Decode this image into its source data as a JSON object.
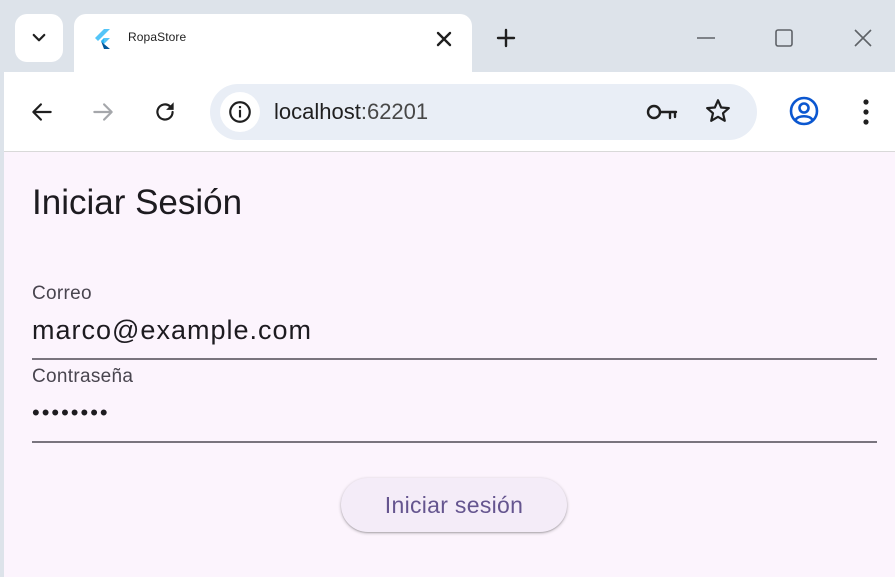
{
  "browser": {
    "tab": {
      "title": "RopaStore",
      "favicon": "flutter-logo-icon"
    },
    "omnibox": {
      "host": "localhost",
      "port": ":62201"
    },
    "icons": {
      "tab_search": "chevron-down-icon",
      "tab_close": "close-icon",
      "new_tab": "plus-icon",
      "minimize": "minimize-icon",
      "maximize": "maximize-icon",
      "window_close": "close-icon",
      "back": "arrow-left-icon",
      "forward": "arrow-right-icon",
      "reload": "reload-icon",
      "site_info": "info-icon",
      "password": "key-icon",
      "bookmark": "star-icon",
      "profile": "account-circle-icon",
      "menu": "more-vertical-icon"
    }
  },
  "page": {
    "title": "Iniciar Sesión",
    "email": {
      "label": "Correo",
      "value": "marco@example.com"
    },
    "password": {
      "label": "Contraseña",
      "value": "••••••••"
    },
    "submit_label": "Iniciar sesión"
  },
  "colors": {
    "page_background": "#fcf4fd",
    "accent": "#65558f",
    "profile_icon": "#0b57d0",
    "tab_strip": "#dde3ea",
    "omnibox": "#e9eef6"
  }
}
